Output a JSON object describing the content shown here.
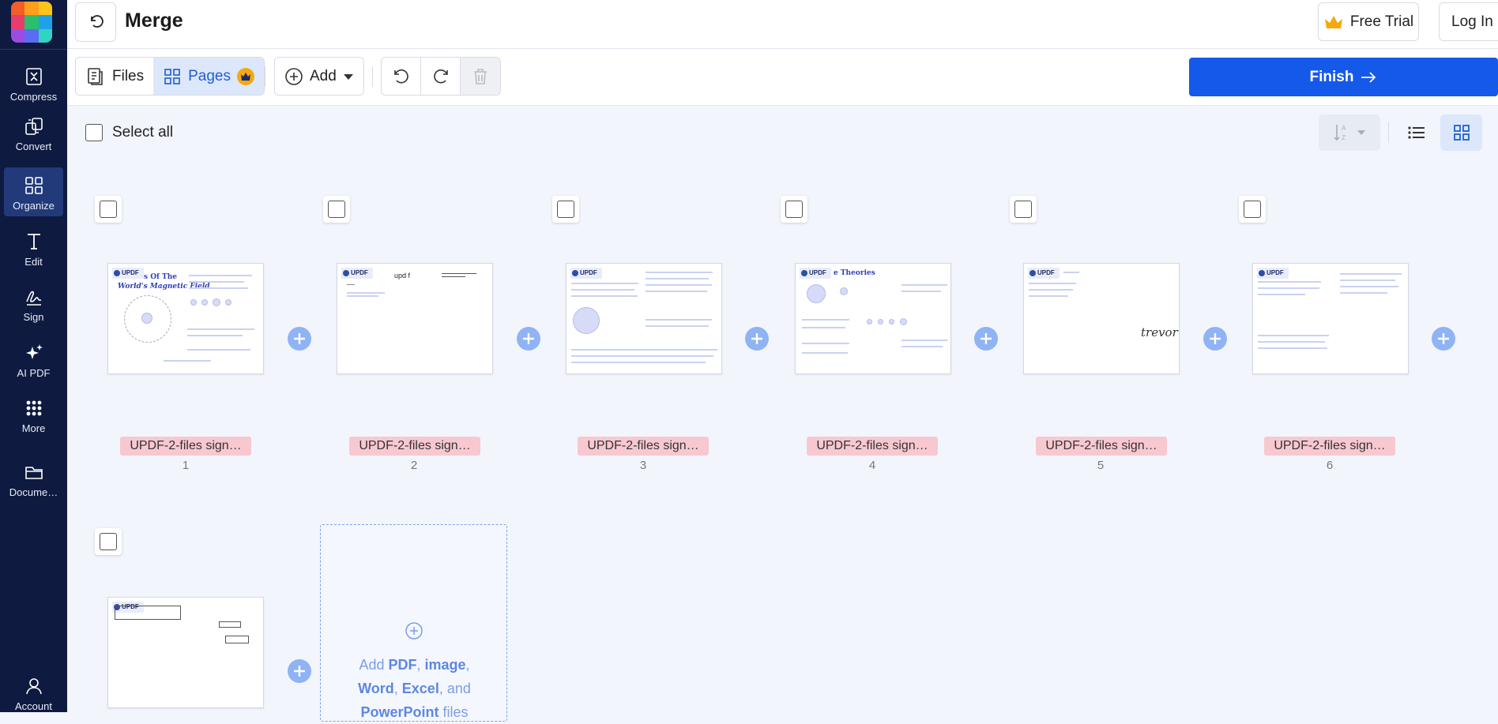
{
  "app": {
    "title": "Merge"
  },
  "sidebar": {
    "items": [
      {
        "label": "Compress",
        "icon": "compress-icon"
      },
      {
        "label": "Convert",
        "icon": "convert-icon"
      },
      {
        "label": "Organize",
        "icon": "organize-icon",
        "active": true
      },
      {
        "label": "Edit",
        "icon": "edit-icon"
      },
      {
        "label": "Sign",
        "icon": "sign-icon"
      },
      {
        "label": "AI PDF",
        "icon": "ai-sparkle-icon"
      },
      {
        "label": "More",
        "icon": "more-grid-icon"
      },
      {
        "label": "Docume…",
        "icon": "folder-icon"
      },
      {
        "label": "Account",
        "icon": "account-icon"
      }
    ]
  },
  "header": {
    "free_trial_label": "Free Trial",
    "login_label": "Log In"
  },
  "toolbar": {
    "files_label": "Files",
    "pages_label": "Pages",
    "add_label": "Add",
    "finish_label": "Finish"
  },
  "select_all_label": "Select all",
  "pages": [
    {
      "file": "UPDF-2-files sign…",
      "number": "1"
    },
    {
      "file": "UPDF-2-files sign…",
      "number": "2"
    },
    {
      "file": "UPDF-2-files sign…",
      "number": "3"
    },
    {
      "file": "UPDF-2-files sign…",
      "number": "4"
    },
    {
      "file": "UPDF-2-files sign…",
      "number": "5"
    },
    {
      "file": "UPDF-2-files sign…",
      "number": "6"
    }
  ],
  "thumb_text": {
    "logo": "UPDF",
    "p1_title": "s Of The",
    "p1_subtitle": "World's Magnetic Field",
    "p2_text": "upd f",
    "p4_title": "e Theories",
    "p5_signature": "trevor"
  },
  "dropzone": {
    "add": "Add",
    "pdf": "PDF",
    "image": "image",
    "word": "Word",
    "excel": "Excel",
    "and": "and",
    "powerpoint": "PowerPoint",
    "files": "files"
  },
  "colors": {
    "sidebar": "#0e1a3f",
    "accent": "#1559ea",
    "chip": "#f8c8d0",
    "plus": "#8fb3f4"
  }
}
